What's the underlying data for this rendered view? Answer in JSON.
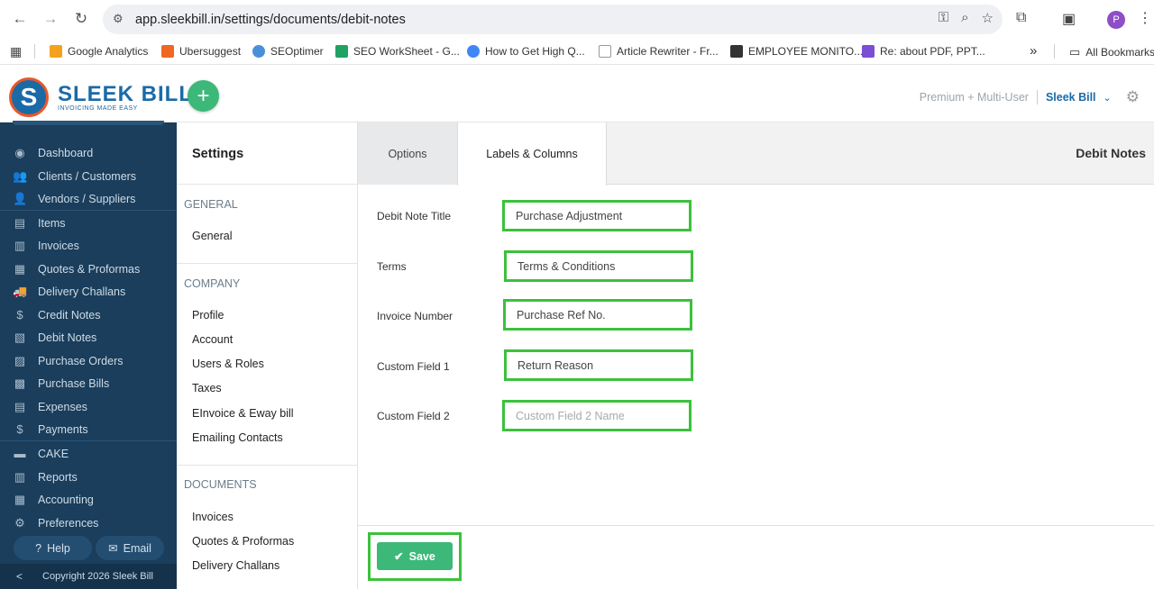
{
  "browser": {
    "url": "app.sleekbill.in/settings/documents/debit-notes",
    "profile_initial": "P",
    "bookmarks": [
      {
        "label": "Google Analytics",
        "color": "#f4a21c"
      },
      {
        "label": "Ubersuggest",
        "color": "#f26522"
      },
      {
        "label": "SEOptimer",
        "color": "#4a90d9"
      },
      {
        "label": "SEO WorkSheet - G...",
        "color": "#1ea362"
      },
      {
        "label": "How to Get High Q...",
        "color": "#4285f4"
      },
      {
        "label": "Article Rewriter - Fr...",
        "color": "#888888"
      },
      {
        "label": "EMPLOYEE MONITO...",
        "color": "#333333"
      },
      {
        "label": "Re: about PDF, PPT...",
        "color": "#7b4fd3"
      }
    ],
    "bookmarks_overflow": "»",
    "all_bookmarks": "All Bookmarks"
  },
  "header": {
    "brand": "SLEEK BILL",
    "tagline": "INVOICING MADE EASY",
    "add_symbol": "+",
    "plan": "Premium + Multi-User",
    "company": "Sleek Bill"
  },
  "sidebar": {
    "items": [
      {
        "label": "Dashboard",
        "icon": "◉"
      },
      {
        "label": "Clients / Customers",
        "icon": "👥"
      },
      {
        "label": "Vendors / Suppliers",
        "icon": "👤"
      },
      {
        "label": "Items",
        "icon": "▤"
      },
      {
        "label": "Invoices",
        "icon": "▥"
      },
      {
        "label": "Quotes & Proformas",
        "icon": "▦"
      },
      {
        "label": "Delivery Challans",
        "icon": "🚚"
      },
      {
        "label": "Credit Notes",
        "icon": "$"
      },
      {
        "label": "Debit Notes",
        "icon": "▧"
      },
      {
        "label": "Purchase Orders",
        "icon": "▨"
      },
      {
        "label": "Purchase Bills",
        "icon": "▩"
      },
      {
        "label": "Expenses",
        "icon": "▤"
      },
      {
        "label": "Payments",
        "icon": "$"
      },
      {
        "label": "CAKE",
        "icon": "▬"
      },
      {
        "label": "Reports",
        "icon": "▥"
      },
      {
        "label": "Accounting",
        "icon": "▦"
      },
      {
        "label": "Preferences",
        "icon": "⚙"
      }
    ],
    "help_label": "Help",
    "email_label": "Email",
    "collapse_symbol": "<",
    "copyright": "Copyright 2026 Sleek Bill"
  },
  "settings_menu": {
    "title": "Settings",
    "general_heading": "GENERAL",
    "general_items": [
      "General"
    ],
    "company_heading": "COMPANY",
    "company_items": [
      "Profile",
      "Account",
      "Users & Roles",
      "Taxes",
      "EInvoice & Eway bill",
      "Emailing Contacts"
    ],
    "documents_heading": "DOCUMENTS",
    "documents_items": [
      "Invoices",
      "Quotes & Proformas",
      "Delivery Challans"
    ]
  },
  "main": {
    "tabs": [
      {
        "label": "Options"
      },
      {
        "label": "Labels & Columns"
      }
    ],
    "section_title": "Debit Notes",
    "fields": [
      {
        "label": "Debit Note Title",
        "value": "Purchase Adjustment",
        "placeholder": ""
      },
      {
        "label": "Terms",
        "value": "Terms & Conditions",
        "placeholder": ""
      },
      {
        "label": "Invoice Number",
        "value": "Purchase Ref No.",
        "placeholder": ""
      },
      {
        "label": "Custom Field 1",
        "value": "Return Reason",
        "placeholder": ""
      },
      {
        "label": "Custom Field 2",
        "value": "",
        "placeholder": "Custom Field 2 Name"
      }
    ],
    "save_label": "Save"
  },
  "colors": {
    "sidebar_bg": "#1a3e5c",
    "accent_green": "#3cb878",
    "highlight_green": "#3cc13c",
    "brand_blue": "#1a6aa8"
  }
}
